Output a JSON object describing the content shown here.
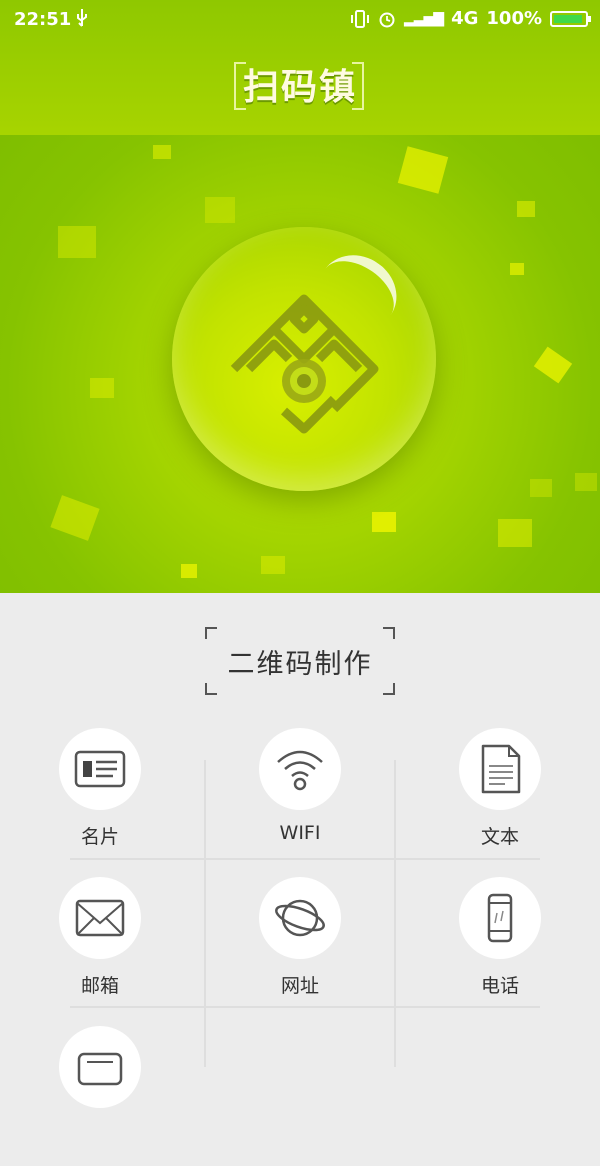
{
  "status_bar": {
    "time": "22:51",
    "network": "4G",
    "battery": "100%"
  },
  "app": {
    "title": "扫码镇"
  },
  "section": {
    "title": "二维码制作"
  },
  "items": [
    {
      "label": "名片",
      "icon": "business-card-icon"
    },
    {
      "label": "WIFI",
      "icon": "wifi-icon"
    },
    {
      "label": "文本",
      "icon": "document-icon"
    },
    {
      "label": "邮箱",
      "icon": "envelope-icon"
    },
    {
      "label": "网址",
      "icon": "globe-icon"
    },
    {
      "label": "电话",
      "icon": "phone-icon"
    },
    {
      "label": "",
      "icon": "sms-icon"
    }
  ],
  "colors": {
    "brand": "#8fc800",
    "hero_accent": "#c2e300"
  }
}
